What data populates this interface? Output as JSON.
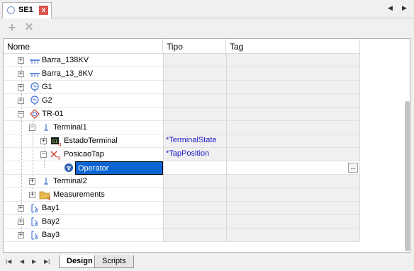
{
  "document_tab": {
    "title": "SE1",
    "close_label": "x"
  },
  "tab_nav": {
    "prev": "◀",
    "next": "▶"
  },
  "toolbar": {
    "add_glyph": "+",
    "delete_glyph": "✕"
  },
  "columns": {
    "name": "Nome",
    "type": "Tipo",
    "tag": "Tag"
  },
  "rows": [
    {
      "label": "Barra_138KV",
      "type": "",
      "icon": "busbar-icon",
      "expander": "+"
    },
    {
      "label": "Barra_13_8KV",
      "type": "",
      "icon": "busbar-icon",
      "expander": "+"
    },
    {
      "label": "G1",
      "type": "",
      "icon": "generator-icon",
      "expander": "+"
    },
    {
      "label": "G2",
      "type": "",
      "icon": "generator-icon",
      "expander": "+"
    },
    {
      "label": "TR-01",
      "type": "",
      "icon": "transformer-icon",
      "expander": "−"
    },
    {
      "label": "Terminal1",
      "type": "",
      "icon": "terminal-icon",
      "expander": "−"
    },
    {
      "label": "EstadoTerminal",
      "type": "*TerminalState",
      "icon": "digital-point-icon",
      "expander": "+"
    },
    {
      "label": "PosicaoTap",
      "type": "*TapPosition",
      "icon": "analog-point-icon",
      "expander": "−"
    },
    {
      "label": "Operator",
      "type": "",
      "icon": "operator-icon",
      "expander": "",
      "editing": true,
      "ellipsis": "..."
    },
    {
      "label": "Terminal2",
      "type": "",
      "icon": "terminal-icon",
      "expander": "+"
    },
    {
      "label": "Measurements",
      "type": "",
      "icon": "measurements-folder-icon",
      "expander": "+"
    },
    {
      "label": "Bay1",
      "type": "",
      "icon": "bay-icon",
      "expander": "+"
    },
    {
      "label": "Bay2",
      "type": "",
      "icon": "bay-icon",
      "expander": "+"
    },
    {
      "label": "Bay3",
      "type": "",
      "icon": "bay-icon",
      "expander": "+"
    }
  ],
  "bottom_nav": {
    "first": "|◀",
    "prev": "◀",
    "next": "▶",
    "last": "▶|"
  },
  "sheet_tabs": {
    "design": "Design",
    "scripts": "Scripts"
  },
  "colors": {
    "selection": "#0a64d2",
    "type_text": "#1c1cc8",
    "accent_icon": "#3b6fd1",
    "red_icon": "#c0392b"
  }
}
